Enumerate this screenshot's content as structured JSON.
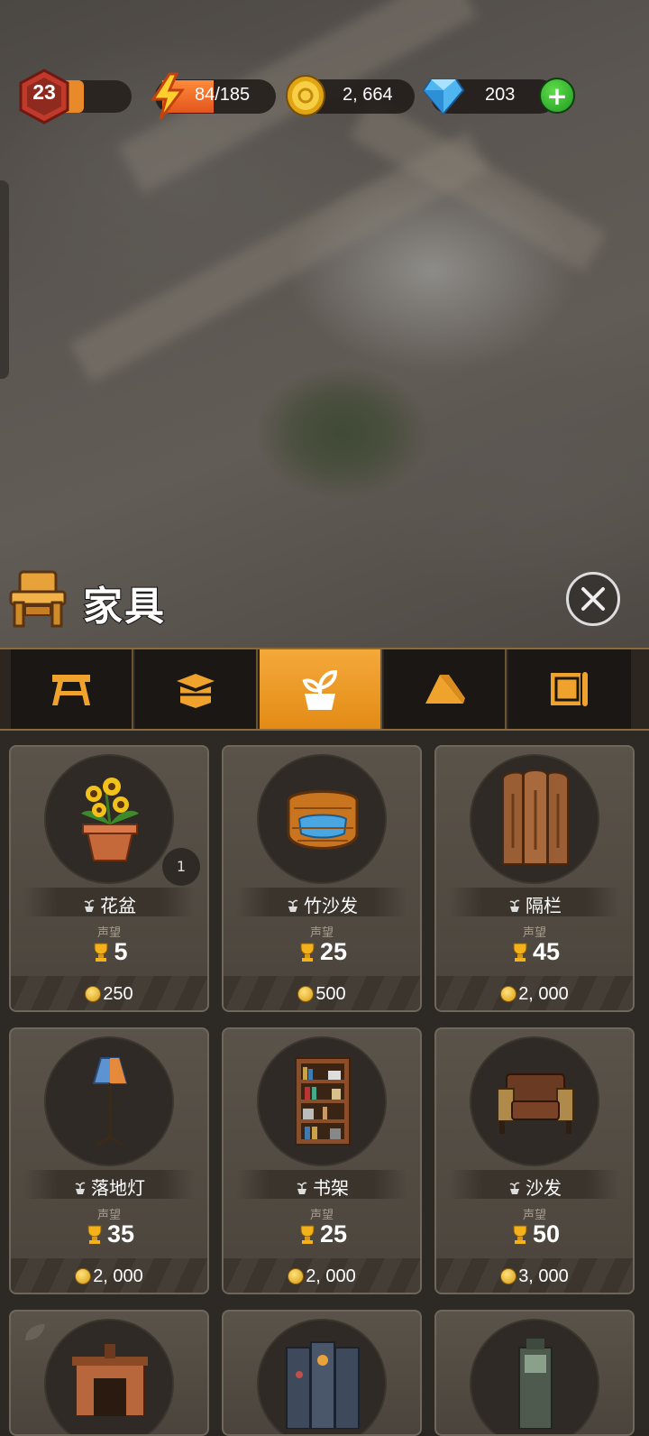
{
  "hud": {
    "level": "23",
    "level_progress": 0.3,
    "energy": "84/185",
    "energy_fraction": 0.454,
    "coins": "2, 664",
    "gems": "203",
    "add_label": "+"
  },
  "panel": {
    "title": "家具",
    "tabs": [
      {
        "icon": "sawhorse-icon",
        "active": false
      },
      {
        "icon": "box-icon",
        "active": false
      },
      {
        "icon": "plant-pot-icon",
        "active": true
      },
      {
        "icon": "tent-icon",
        "active": false
      },
      {
        "icon": "blueprint-icon",
        "active": false
      }
    ],
    "reputation_label": "声望",
    "items": [
      {
        "name": "花盆",
        "reputation": "5",
        "price": "250",
        "count": "1"
      },
      {
        "name": "竹沙发",
        "reputation": "25",
        "price": "500"
      },
      {
        "name": "隔栏",
        "reputation": "45",
        "price": "2, 000"
      },
      {
        "name": "落地灯",
        "reputation": "35",
        "price": "2, 000"
      },
      {
        "name": "书架",
        "reputation": "25",
        "price": "2, 000"
      },
      {
        "name": "沙发",
        "reputation": "50",
        "price": "3, 000"
      }
    ]
  },
  "colors": {
    "accent": "#e8911c",
    "panel": "#2d2924"
  }
}
